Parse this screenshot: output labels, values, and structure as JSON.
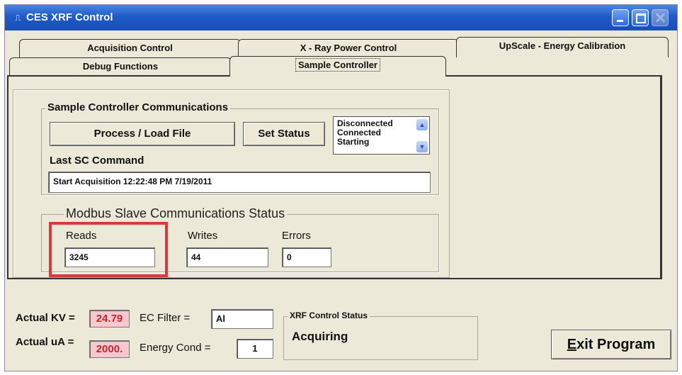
{
  "window": {
    "title": "CES XRF Control",
    "app_icon": "oscilloscope-icon"
  },
  "tabs": {
    "row_back": [
      {
        "label": "Acquisition Control"
      },
      {
        "label": "X - Ray Power Control"
      },
      {
        "label": "UpScale - Energy Calibration"
      }
    ],
    "row_front": [
      {
        "label": "Debug Functions"
      },
      {
        "label": "Sample Controller",
        "selected": true
      }
    ]
  },
  "sample_controller": {
    "group_title": "Sample Controller Communications",
    "process_button": "Process / Load File",
    "set_status_button": "Set Status",
    "status_options": [
      "Disconnected",
      "Connected",
      "Starting"
    ],
    "last_cmd_label": "Last SC Command",
    "last_cmd_value": "Start Acquisition 12:22:48 PM  7/19/2011"
  },
  "modbus": {
    "group_title": "Modbus Slave Communications  Status",
    "reads_label": "Reads",
    "reads_value": "3245",
    "writes_label": "Writes",
    "writes_value": "44",
    "errors_label": "Errors",
    "errors_value": "0",
    "highlight_color": "#d83a3a"
  },
  "bottom": {
    "actual_kv_label": "Actual KV =",
    "actual_kv_value": "24.79",
    "actual_ua_label": "Actual uA =",
    "actual_ua_value": "2000.",
    "ec_filter_label": "EC Filter =",
    "ec_filter_value": "Al",
    "energy_cond_label": "Energy Cond =",
    "energy_cond_value": "1",
    "status_title": "XRF Control Status",
    "status_value": "Acquiring",
    "exit_button_first": "E",
    "exit_button_rest": "xit Program"
  },
  "colors": {
    "titlebar": "#1e5ac8",
    "window_bg": "#ece9d8",
    "pink_value_bg": "#f8c8d0",
    "pink_value_text": "#c02828"
  }
}
